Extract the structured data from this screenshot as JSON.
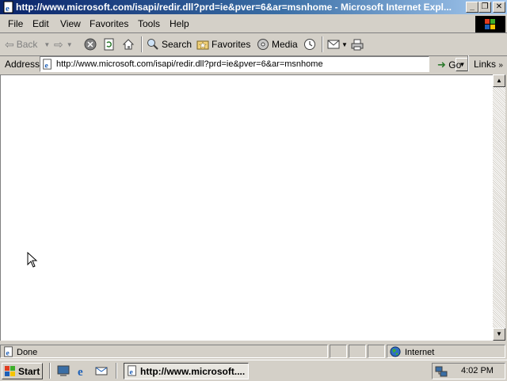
{
  "window": {
    "title": "http://www.microsoft.com/isapi/redir.dll?prd=ie&pver=6&ar=msnhome - Microsoft Internet Expl...",
    "buttons": [
      "minimize-icon",
      "restore-icon",
      "close-icon"
    ]
  },
  "menu": {
    "items": [
      "File",
      "Edit",
      "View",
      "Favorites",
      "Tools",
      "Help"
    ]
  },
  "toolbar": {
    "back": "Back",
    "search": "Search",
    "favorites": "Favorites",
    "media": "Media"
  },
  "address": {
    "label": "Address",
    "url": "http://www.microsoft.com/isapi/redir.dll?prd=ie&pver=6&ar=msnhome",
    "go": "Go",
    "links": "Links"
  },
  "status": {
    "text": "Done",
    "zone": "Internet"
  },
  "taskbar": {
    "start": "Start",
    "task": "http://www.microsoft....",
    "clock": "4:02 PM"
  },
  "colors": {
    "titlebar_start": "#0a246a",
    "titlebar_end": "#a6caf0",
    "face": "#d4d0c8"
  }
}
